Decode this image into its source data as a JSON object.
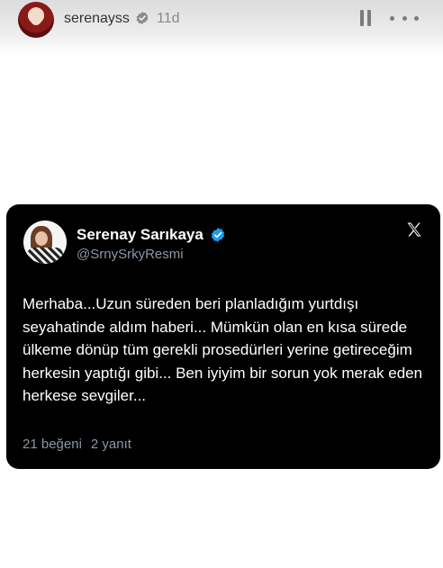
{
  "story": {
    "username": "serenayss",
    "time_ago": "11d",
    "icons": {
      "verified": "verified-badge-icon",
      "pause": "pause-icon",
      "more": "more-options-icon"
    }
  },
  "tweet": {
    "display_name": "Serenay Sarıkaya",
    "handle": "@SrnySrkyResmi",
    "text": "Merhaba...Uzun süreden beri planladığım yurtdışı seyahatinde aldım haberi... Mümkün olan en kısa sürede ülkeme dönüp tüm gerekli prosedürleri yerine getireceğim herkesin yaptığı gibi... Ben iyiyim bir sorun yok merak eden herkese sevgiler...",
    "likes": "21 beğeni",
    "replies": "2 yanıt",
    "icons": {
      "verified": "verified-badge-icon",
      "platform": "x-logo-icon"
    }
  },
  "colors": {
    "verified_blue": "#1d9bf0",
    "card_background": "#000000",
    "secondary_text": "#8b98a5",
    "header_icon_gray": "#7c7c7c"
  }
}
